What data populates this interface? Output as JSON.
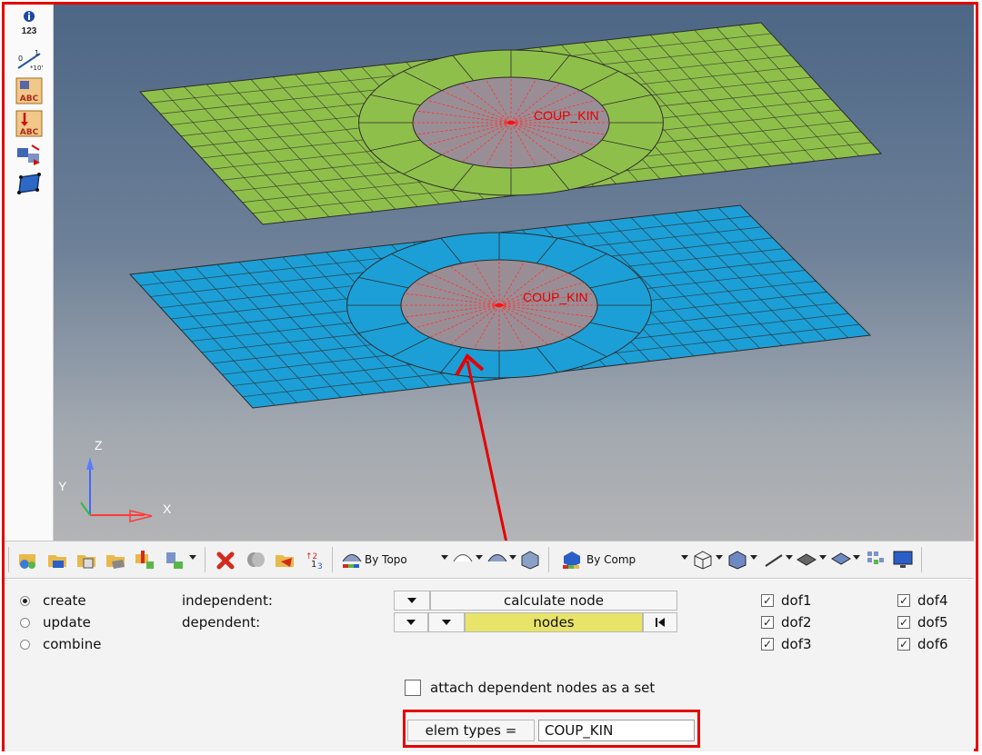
{
  "viewport": {
    "top_label": "COUP_KIN",
    "bottom_label": "COUP_KIN",
    "axis": {
      "z": "Z",
      "y": "Y",
      "x": "X"
    }
  },
  "left_toolbar": {
    "info_label": "123",
    "icons": [
      "info-icon",
      "scale-icon",
      "label-abc-icon",
      "label-abc-arrow-icon",
      "element-transform-icon",
      "select-face-icon"
    ]
  },
  "toolbar": {
    "by_topo": "By Topo",
    "by_comp": "By Comp",
    "icons": [
      "component-icon",
      "folder-icon",
      "folder-img-icon",
      "component-edit-icon",
      "color-icon",
      "assign-icon",
      "delete-icon",
      "cylinder-icon",
      "folder-open-icon",
      "numbering-icon",
      "surface-icon",
      "shell-icon",
      "cube-icon",
      "comp-color-icon",
      "wireframe-icon",
      "solid-icon",
      "line-icon",
      "mesh-icon",
      "plane-icon",
      "grid-icon",
      "monitor-icon"
    ]
  },
  "panel": {
    "radios": [
      {
        "label": "create",
        "selected": true
      },
      {
        "label": "update",
        "selected": false
      },
      {
        "label": "combine",
        "selected": false
      }
    ],
    "independent_label": "independent:",
    "dependent_label": "dependent:",
    "calculate_node": "calculate node",
    "nodes": "nodes",
    "dofs": [
      {
        "label": "dof1",
        "checked": true
      },
      {
        "label": "dof2",
        "checked": true
      },
      {
        "label": "dof3",
        "checked": true
      },
      {
        "label": "dof4",
        "checked": true
      },
      {
        "label": "dof5",
        "checked": true
      },
      {
        "label": "dof6",
        "checked": true
      }
    ],
    "attach_label": "attach dependent nodes as a set",
    "elem_types_label": "elem types =",
    "elem_types_value": "COUP_KIN"
  },
  "colors": {
    "highlight": "#e60000",
    "top_plate": "#8fbf4b",
    "bottom_plate": "#1c9fd6",
    "nodes_field": "#e8e46a"
  }
}
